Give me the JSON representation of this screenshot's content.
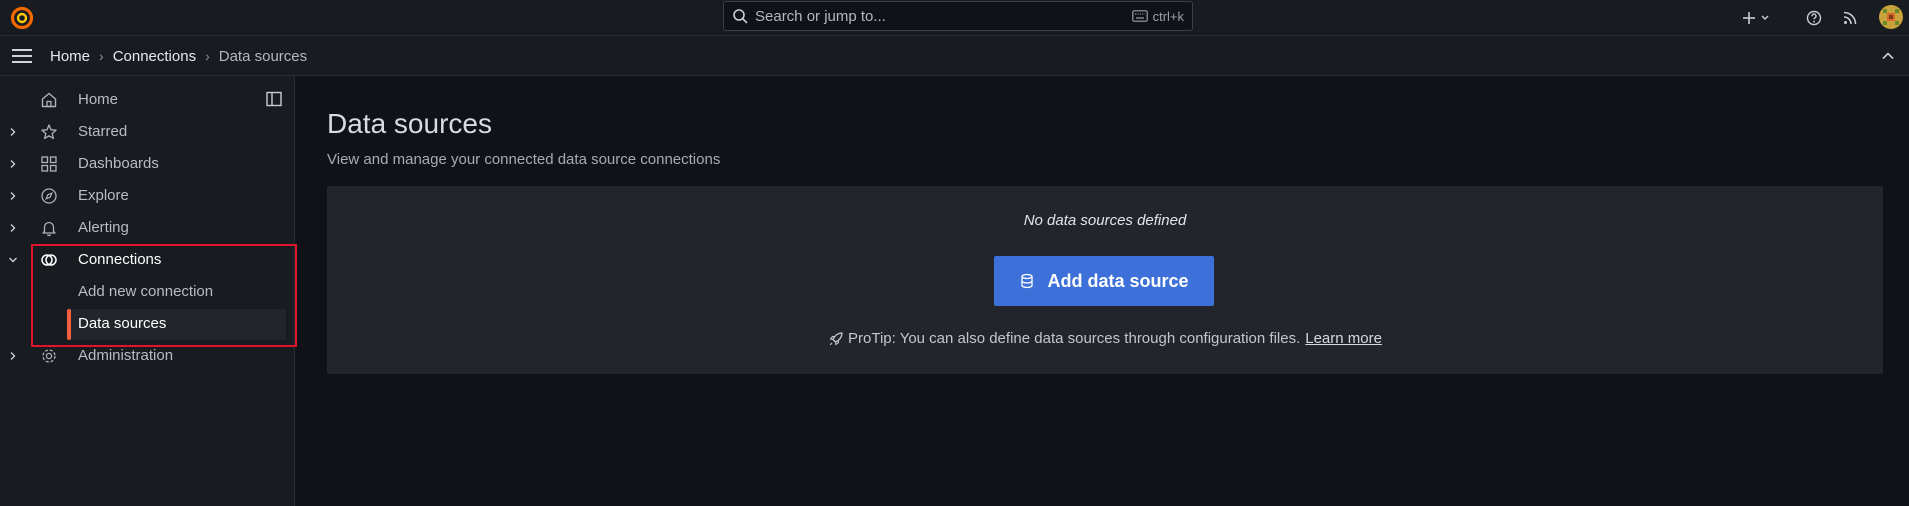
{
  "topbar": {
    "search_placeholder": "Search or jump to...",
    "shortcut": "ctrl+k"
  },
  "breadcrumb": {
    "items": [
      "Home",
      "Connections"
    ],
    "current": "Data sources",
    "separator": "›"
  },
  "sidebar": {
    "items": [
      {
        "label": "Home",
        "icon": "home-icon"
      },
      {
        "label": "Starred",
        "icon": "star-icon"
      },
      {
        "label": "Dashboards",
        "icon": "apps-icon"
      },
      {
        "label": "Explore",
        "icon": "compass-icon"
      },
      {
        "label": "Alerting",
        "icon": "bell-icon"
      },
      {
        "label": "Connections",
        "icon": "connections-icon"
      },
      {
        "label": "Administration",
        "icon": "cog-icon"
      }
    ],
    "subitems": [
      {
        "label": "Add new connection"
      },
      {
        "label": "Data sources"
      }
    ]
  },
  "main": {
    "title": "Data sources",
    "subtitle": "View and manage your connected data source connections",
    "empty_message": "No data sources defined",
    "add_button_label": "Add data source",
    "protip_text": "ProTip: You can also define data sources through configuration files.",
    "learn_more": "Learn more"
  },
  "colors": {
    "accent": "#3d71d9",
    "active_indicator": "#f55f3e",
    "highlight_box": "#e0152b",
    "background": "#111217",
    "panel": "#22252b"
  }
}
